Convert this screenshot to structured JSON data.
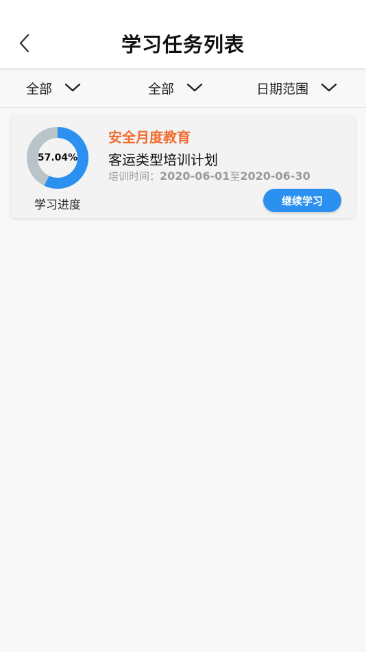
{
  "header": {
    "title": "学习任务列表",
    "back_icon": "chevron-left-icon"
  },
  "filters": [
    {
      "label": "全部",
      "icon": "chevron-down-icon"
    },
    {
      "label": "全部",
      "icon": "chevron-down-icon"
    },
    {
      "label": "日期范围",
      "icon": "chevron-down-icon"
    }
  ],
  "tasks": [
    {
      "category": "安全月度教育",
      "plan_name": "客运类型培训计划",
      "date_label": "培训时间：",
      "date_start": "2020-06-01",
      "date_sep": "至",
      "date_end": "2020-06-30",
      "progress_text": "57.04%",
      "progress_value": 0.5704,
      "progress_caption": "学习进度",
      "action_label": "继续学习"
    }
  ],
  "colors": {
    "accent_blue": "#2b90ef",
    "ring_track": "#b8c4c8",
    "category_orange": "#f26b2e",
    "muted_text": "#9a9a9a"
  }
}
